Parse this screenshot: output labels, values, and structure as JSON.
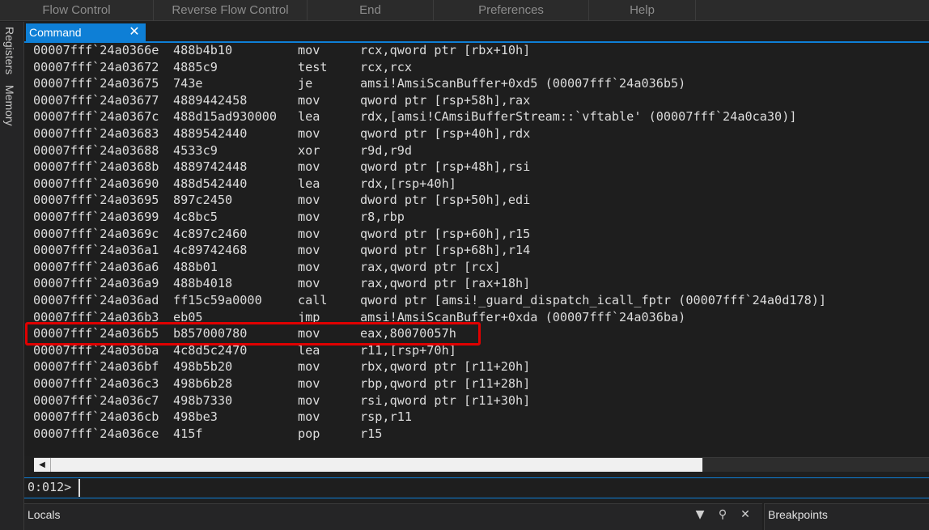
{
  "ribbon": {
    "items": [
      "Flow Control",
      "Reverse Flow Control",
      "End",
      "Preferences",
      "Help"
    ]
  },
  "side_tabs": [
    "Registers",
    "Memory"
  ],
  "tab": {
    "label": "Command",
    "close_icon": "close-icon"
  },
  "disassembly": [
    {
      "addr": "00007fff`24a0366e",
      "bytes": "488b4b10",
      "mnem": "mov",
      "ops": "rcx,qword ptr [rbx+10h]"
    },
    {
      "addr": "00007fff`24a03672",
      "bytes": "4885c9",
      "mnem": "test",
      "ops": "rcx,rcx"
    },
    {
      "addr": "00007fff`24a03675",
      "bytes": "743e",
      "mnem": "je",
      "ops": "amsi!AmsiScanBuffer+0xd5 (00007fff`24a036b5)"
    },
    {
      "addr": "00007fff`24a03677",
      "bytes": "4889442458",
      "mnem": "mov",
      "ops": "qword ptr [rsp+58h],rax"
    },
    {
      "addr": "00007fff`24a0367c",
      "bytes": "488d15ad930000",
      "mnem": "lea",
      "ops": "rdx,[amsi!CAmsiBufferStream::`vftable' (00007fff`24a0ca30)]"
    },
    {
      "addr": "00007fff`24a03683",
      "bytes": "4889542440",
      "mnem": "mov",
      "ops": "qword ptr [rsp+40h],rdx"
    },
    {
      "addr": "00007fff`24a03688",
      "bytes": "4533c9",
      "mnem": "xor",
      "ops": "r9d,r9d"
    },
    {
      "addr": "00007fff`24a0368b",
      "bytes": "4889742448",
      "mnem": "mov",
      "ops": "qword ptr [rsp+48h],rsi"
    },
    {
      "addr": "00007fff`24a03690",
      "bytes": "488d542440",
      "mnem": "lea",
      "ops": "rdx,[rsp+40h]"
    },
    {
      "addr": "00007fff`24a03695",
      "bytes": "897c2450",
      "mnem": "mov",
      "ops": "dword ptr [rsp+50h],edi"
    },
    {
      "addr": "00007fff`24a03699",
      "bytes": "4c8bc5",
      "mnem": "mov",
      "ops": "r8,rbp"
    },
    {
      "addr": "00007fff`24a0369c",
      "bytes": "4c897c2460",
      "mnem": "mov",
      "ops": "qword ptr [rsp+60h],r15"
    },
    {
      "addr": "00007fff`24a036a1",
      "bytes": "4c89742468",
      "mnem": "mov",
      "ops": "qword ptr [rsp+68h],r14"
    },
    {
      "addr": "00007fff`24a036a6",
      "bytes": "488b01",
      "mnem": "mov",
      "ops": "rax,qword ptr [rcx]"
    },
    {
      "addr": "00007fff`24a036a9",
      "bytes": "488b4018",
      "mnem": "mov",
      "ops": "rax,qword ptr [rax+18h]"
    },
    {
      "addr": "00007fff`24a036ad",
      "bytes": "ff15c59a0000",
      "mnem": "call",
      "ops": "qword ptr [amsi!_guard_dispatch_icall_fptr (00007fff`24a0d178)]"
    },
    {
      "addr": "00007fff`24a036b3",
      "bytes": "eb05",
      "mnem": "jmp",
      "ops": "amsi!AmsiScanBuffer+0xda (00007fff`24a036ba)"
    },
    {
      "addr": "00007fff`24a036b5",
      "bytes": "b857000780",
      "mnem": "mov",
      "ops": "eax,80070057h"
    },
    {
      "addr": "00007fff`24a036ba",
      "bytes": "4c8d5c2470",
      "mnem": "lea",
      "ops": "r11,[rsp+70h]"
    },
    {
      "addr": "00007fff`24a036bf",
      "bytes": "498b5b20",
      "mnem": "mov",
      "ops": "rbx,qword ptr [r11+20h]"
    },
    {
      "addr": "00007fff`24a036c3",
      "bytes": "498b6b28",
      "mnem": "mov",
      "ops": "rbp,qword ptr [r11+28h]"
    },
    {
      "addr": "00007fff`24a036c7",
      "bytes": "498b7330",
      "mnem": "mov",
      "ops": "rsi,qword ptr [r11+30h]"
    },
    {
      "addr": "00007fff`24a036cb",
      "bytes": "498be3",
      "mnem": "mov",
      "ops": "rsp,r11"
    },
    {
      "addr": "00007fff`24a036ce",
      "bytes": "415f",
      "mnem": "pop",
      "ops": "r15"
    }
  ],
  "highlighted_row": 17,
  "prompt": {
    "label": "0:012>",
    "value": ""
  },
  "locals_panel": {
    "title": "Locals"
  },
  "breakpoints_panel": {
    "title": "Breakpoints"
  },
  "colors": {
    "accent": "#0e7fd6",
    "highlight": "#e00000"
  }
}
